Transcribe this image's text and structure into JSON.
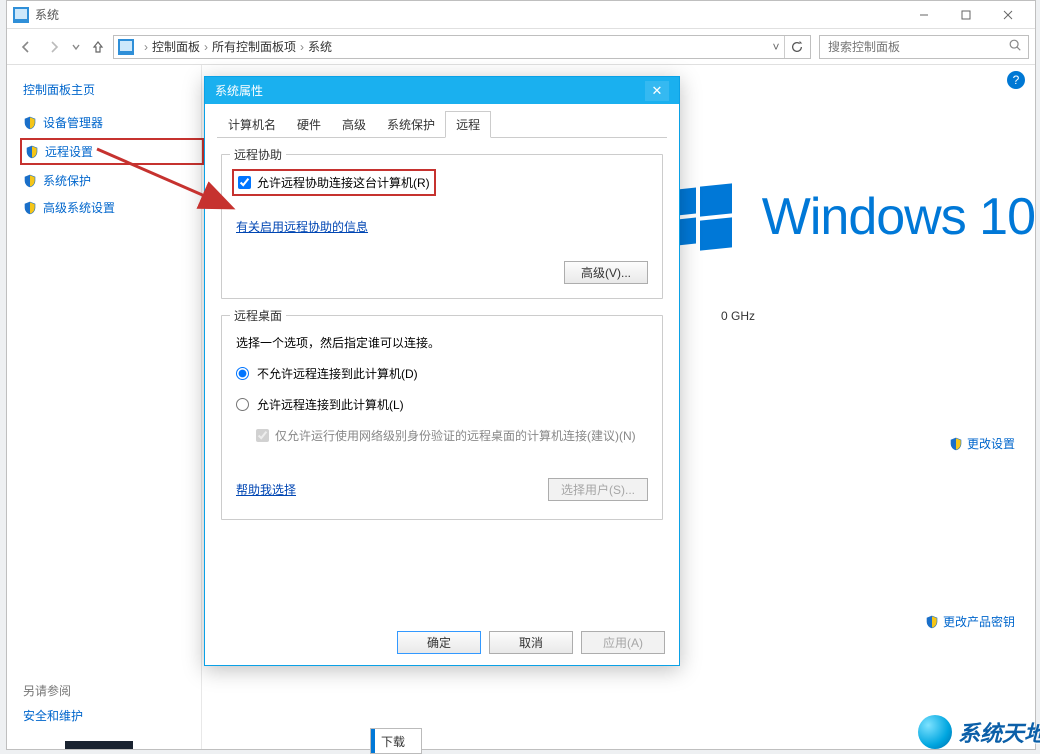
{
  "window": {
    "title": "系统",
    "breadcrumbs": [
      "控制面板",
      "所有控制面板项",
      "系统"
    ],
    "search_placeholder": "搜索控制面板"
  },
  "sidebar": {
    "home": "控制面板主页",
    "items": [
      {
        "label": "设备管理器"
      },
      {
        "label": "远程设置"
      },
      {
        "label": "系统保护"
      },
      {
        "label": "高级系统设置"
      }
    ],
    "see_also_header": "另请参阅",
    "see_also_link": "安全和维护"
  },
  "main": {
    "win10_text": "Windows 10",
    "ghz": "0 GHz",
    "change_settings": "更改设置",
    "change_product_key": "更改产品密钥"
  },
  "dialog": {
    "title": "系统属性",
    "tabs": [
      "计算机名",
      "硬件",
      "高级",
      "系统保护",
      "远程"
    ],
    "active_tab": 4,
    "group_remote_assist": "远程协助",
    "allow_remote_assist": "允许远程协助连接这台计算机(R)",
    "remote_assist_info": "有关启用远程协助的信息",
    "advanced_btn": "高级(V)...",
    "group_remote_desktop": "远程桌面",
    "remote_desktop_instruction": "选择一个选项，然后指定谁可以连接。",
    "radio_disallow": "不允许远程连接到此计算机(D)",
    "radio_allow": "允许远程连接到此计算机(L)",
    "nla_checkbox": "仅允许运行使用网络级别身份验证的远程桌面的计算机连接(建议)(N)",
    "help_choose": "帮助我选择",
    "select_users_btn": "选择用户(S)...",
    "ok": "确定",
    "cancel": "取消",
    "apply": "应用(A)"
  },
  "misc": {
    "download_label": "下载"
  },
  "watermark": "系统天地"
}
